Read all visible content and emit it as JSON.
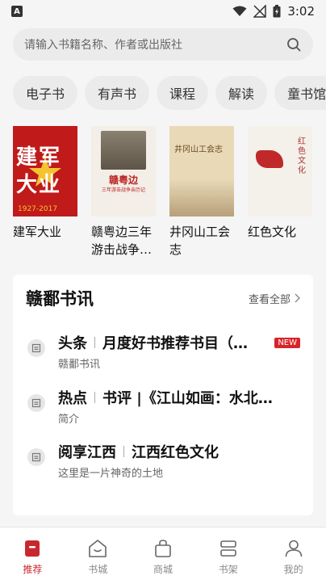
{
  "status": {
    "time": "3:02",
    "app_badge": "A"
  },
  "search": {
    "placeholder": "请输入书籍名称、作者或出版社"
  },
  "categories": [
    "电子书",
    "有声书",
    "课程",
    "解读",
    "童书馆"
  ],
  "books": [
    {
      "title": "建军大业",
      "cover_text": "建军大业",
      "cover_years": "1927-2017"
    },
    {
      "title": "赣粤边三年游击战争…",
      "cover_text": "赣粤边",
      "cover_subtitle": "三年游击战争亲历记"
    },
    {
      "title": "井冈山工会志",
      "cover_text": "井冈山工会志"
    },
    {
      "title": "红色文化",
      "cover_text": "红色文化"
    }
  ],
  "news_section": {
    "title": "赣鄱书讯",
    "view_all": "查看全部",
    "items": [
      {
        "tag": "头条",
        "headline": "月度好书推荐书目（…",
        "sub": "赣鄱书讯",
        "badge": "NEW"
      },
      {
        "tag": "热点",
        "headline": "书评 |《江山如画：水北…",
        "sub": "简介",
        "badge": ""
      },
      {
        "tag": "阅享江西",
        "headline": "江西红色文化",
        "sub": "这里是一片神奇的土地",
        "badge": ""
      }
    ]
  },
  "tabbar": [
    {
      "label": "推荐",
      "icon": "recommend-icon",
      "active": true
    },
    {
      "label": "书城",
      "icon": "bookstore-icon",
      "active": false
    },
    {
      "label": "商城",
      "icon": "shop-icon",
      "active": false
    },
    {
      "label": "书架",
      "icon": "bookshelf-icon",
      "active": false
    },
    {
      "label": "我的",
      "icon": "profile-icon",
      "active": false
    }
  ],
  "colors": {
    "accent": "#c8282d",
    "card_bg": "#ffffff",
    "page_bg": "#f5f5f5"
  }
}
